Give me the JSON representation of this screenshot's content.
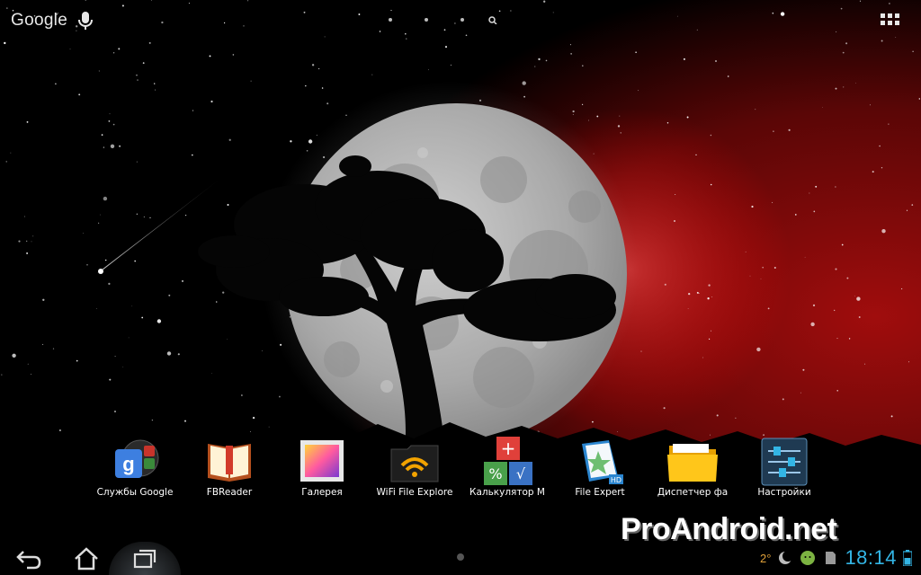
{
  "topbar": {
    "google_label": "Google"
  },
  "apps": [
    {
      "label": "Службы Google",
      "icon": "google-services-icon"
    },
    {
      "label": "FBReader",
      "icon": "book-icon"
    },
    {
      "label": "Галерея",
      "icon": "gallery-icon"
    },
    {
      "label": "WiFi File Explore",
      "icon": "wifi-icon"
    },
    {
      "label": "Калькулятор М",
      "icon": "calculator-icon"
    },
    {
      "label": "File Expert",
      "icon": "file-expert-icon"
    },
    {
      "label": "Диспетчер фа",
      "icon": "folder-icon"
    },
    {
      "label": "Настройки",
      "icon": "settings-sliders-icon"
    }
  ],
  "watermark": "ProAndroid.net",
  "status": {
    "temperature": "2°",
    "time": "18:14"
  },
  "colors": {
    "clock": "#33b5e5",
    "sky_red": "#8a0b0b",
    "moon": "#b9b9b9"
  }
}
